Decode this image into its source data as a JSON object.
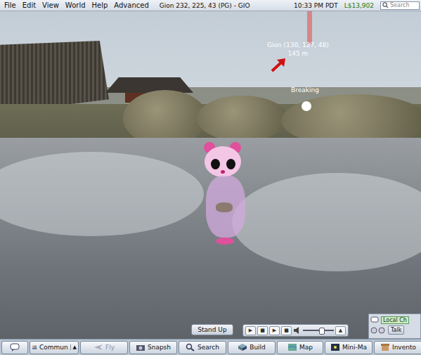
{
  "menu_bar": {
    "items": [
      "File",
      "Edit",
      "View",
      "World",
      "Help",
      "Advanced"
    ],
    "location": "Gion 232, 225, 43 (PG) - GIO",
    "time": "10:33 PM PDT",
    "balance": "L$13,902",
    "search": {
      "placeholder": "Search"
    }
  },
  "scene": {
    "beacon": {
      "name": "Gion (130, 127, 48)",
      "distance": "145 m"
    },
    "hover_label": "Breaking"
  },
  "stand_up_button": "Stand Up",
  "media_controls": {
    "buttons": [
      "▶",
      "■",
      "▶",
      "■"
    ],
    "volume": 0.6,
    "expand": "▲"
  },
  "chat_panel": {
    "tab": "Local Ch",
    "talk": "Talk"
  },
  "toolbar": [
    {
      "label": "",
      "disabled": false,
      "menu": ""
    },
    {
      "label": "Commun",
      "disabled": false,
      "menu": "▲"
    },
    {
      "label": "Fly",
      "disabled": true,
      "menu": ""
    },
    {
      "label": "Snapsh",
      "disabled": false,
      "menu": ""
    },
    {
      "label": "Search",
      "disabled": false,
      "menu": ""
    },
    {
      "label": "Build",
      "disabled": false,
      "menu": ""
    },
    {
      "label": "Map",
      "disabled": false,
      "menu": ""
    },
    {
      "label": "Mini-Ma",
      "disabled": false,
      "menu": ""
    },
    {
      "label": "Invento",
      "disabled": false,
      "menu": ""
    }
  ]
}
